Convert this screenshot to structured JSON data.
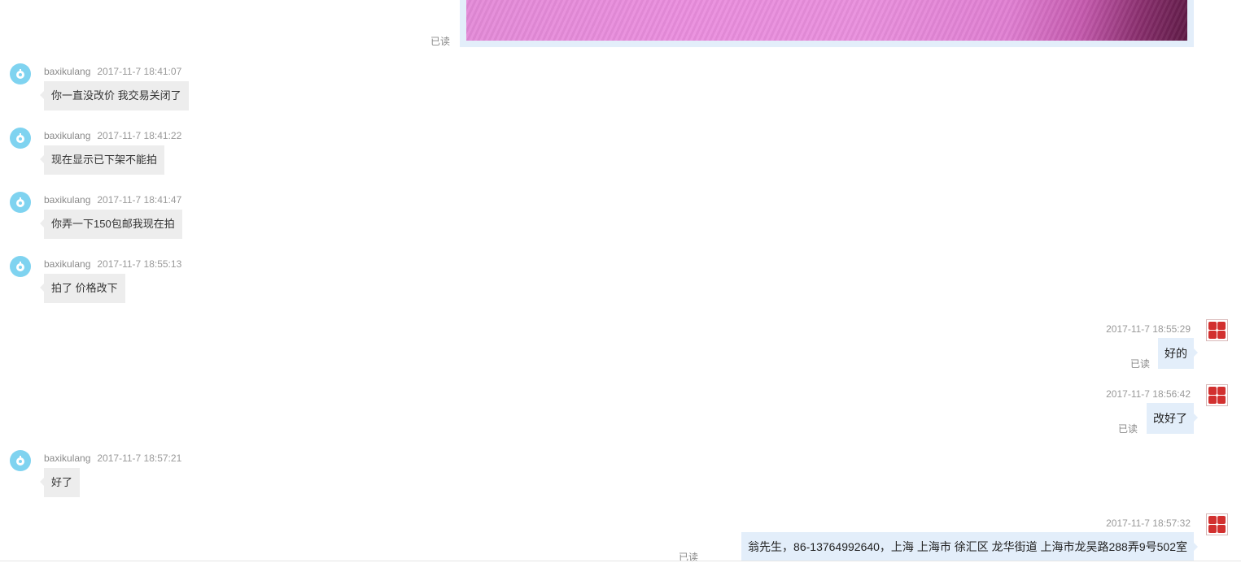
{
  "read_label": "已读",
  "colors": {
    "own_bubble": "#e3eefa",
    "other_bubble": "#ededed",
    "other_avatar": "#7fd3f0",
    "own_avatar": "#d2302f"
  },
  "image_message": {
    "read": "已读"
  },
  "messages": [
    {
      "side": "left",
      "sender": "baxikulang",
      "time": "2017-11-7 18:41:07",
      "text": "你一直没改价 我交易关闭了"
    },
    {
      "side": "left",
      "sender": "baxikulang",
      "time": "2017-11-7 18:41:22",
      "text": "现在显示已下架不能拍"
    },
    {
      "side": "left",
      "sender": "baxikulang",
      "time": "2017-11-7 18:41:47",
      "text": "你弄一下150包邮我现在拍"
    },
    {
      "side": "left",
      "sender": "baxikulang",
      "time": "2017-11-7 18:55:13",
      "text": "拍了 价格改下"
    },
    {
      "side": "right",
      "time": "2017-11-7 18:55:29",
      "text": "好的",
      "read": "已读"
    },
    {
      "side": "right",
      "time": "2017-11-7 18:56:42",
      "text": "改好了",
      "read": "已读"
    },
    {
      "side": "left",
      "sender": "baxikulang",
      "time": "2017-11-7 18:57:21",
      "text": "好了"
    },
    {
      "side": "right",
      "time": "2017-11-7 18:57:32",
      "text": "翁先生，86-13764992640，上海 上海市 徐汇区 龙华街道 上海市龙吴路288弄9号502室",
      "read": "已读"
    }
  ]
}
